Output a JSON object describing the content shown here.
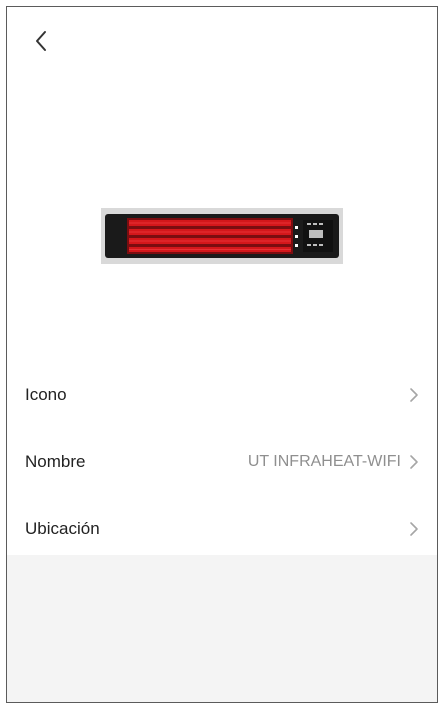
{
  "header": {
    "back_icon": "chevron-left-icon"
  },
  "device": {
    "image": "infrared-heater-image"
  },
  "settings": {
    "rows": [
      {
        "label": "Icono",
        "value": "",
        "icon": "chevron-right-icon"
      },
      {
        "label": "Nombre",
        "value": "UT INFRAHEAT-WIFI",
        "icon": "chevron-right-icon"
      },
      {
        "label": "Ubicación",
        "value": "",
        "icon": "chevron-right-icon"
      }
    ]
  },
  "colors": {
    "heater_body": "#1a1a1a",
    "heater_element": "#d4171b",
    "secondary_text": "#8f8f8f",
    "lower_background": "#f4f4f4"
  }
}
